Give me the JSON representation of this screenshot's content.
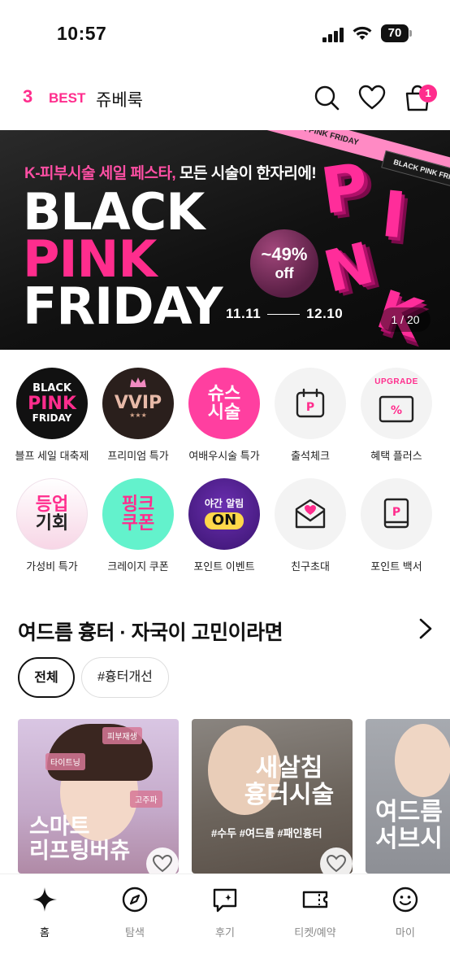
{
  "status_bar": {
    "time": "10:57",
    "battery": "70"
  },
  "top_tabs": {
    "tab1": "3",
    "tab2": "BEST",
    "tab3": "쥬베룩"
  },
  "cart": {
    "badge": "1"
  },
  "banner": {
    "subtitle_pink": "K-피부시술 세일 페스타,",
    "subtitle_white": " 모든 시술이 한자리에!",
    "line1": "BLACK",
    "line2": "PINK",
    "line3": "FRIDAY",
    "discount": "~49%",
    "discount_suffix": "off",
    "date_start": "11.11",
    "date_end": "12.10",
    "ribbon": "BLACK PINK FRIDAY",
    "ribbon2": "BLACK PINK FRIDAY",
    "art": [
      "P",
      "I",
      "N",
      "K"
    ],
    "page_indicator": "1 / 20"
  },
  "categories": [
    {
      "label": "블프 세일 대축제",
      "art": [
        "BLACK",
        "PINK",
        "FRIDAY"
      ]
    },
    {
      "label": "프리미엄 특가",
      "art": [
        "VVIP",
        "★★★"
      ]
    },
    {
      "label": "여배우시술 특가",
      "art": [
        "슈스",
        "시술"
      ]
    },
    {
      "label": "출석체크",
      "art": [
        "P"
      ]
    },
    {
      "label": "혜택 플러스",
      "art": [
        "UPGRADE",
        "%"
      ]
    },
    {
      "label": "가성비 특가",
      "art": [
        "등업",
        "기회"
      ]
    },
    {
      "label": "크레이지 쿠폰",
      "art": [
        "핑크",
        "쿠폰"
      ]
    },
    {
      "label": "포인트 이벤트",
      "art": [
        "야간 알림",
        "ON"
      ]
    },
    {
      "label": "친구초대",
      "art": []
    },
    {
      "label": "포인트 백서",
      "art": [
        "P"
      ]
    }
  ],
  "section": {
    "title": "여드름 흉터 · 자국이 고민이라면",
    "chips": [
      "전체",
      "#흉터개선"
    ]
  },
  "cards": [
    {
      "tags": [
        "피부재생",
        "타이트닝",
        "고주파"
      ],
      "title_line1": "스마트",
      "title_line2": "리프팅버츄"
    },
    {
      "title_line1": "새살침",
      "title_line2": "흉터시술",
      "hashtags": "#수두 #여드름 #패인흉터"
    },
    {
      "title_line1": "여드름",
      "title_line2": "서브시"
    }
  ],
  "bottom_nav": [
    {
      "label": "홈",
      "icon": "sparkle-icon",
      "active": true
    },
    {
      "label": "탐색",
      "icon": "compass-icon",
      "active": false
    },
    {
      "label": "후기",
      "icon": "review-icon",
      "active": false
    },
    {
      "label": "티켓/예약",
      "icon": "ticket-icon",
      "active": false
    },
    {
      "label": "마이",
      "icon": "smile-icon",
      "active": false
    }
  ],
  "colors": {
    "accent": "#ff2d8d",
    "text": "#111111",
    "muted": "#888888"
  }
}
